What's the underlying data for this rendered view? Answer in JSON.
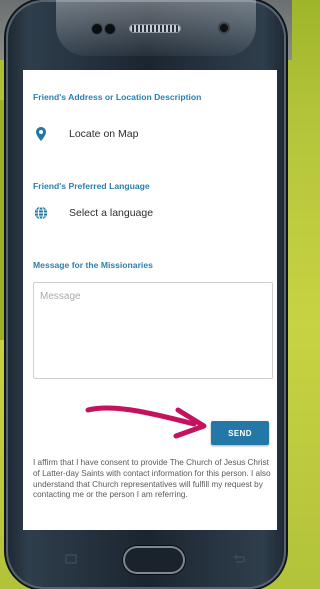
{
  "form": {
    "address_label": "Friend's Address or Location Description",
    "locate_text": "Locate on Map",
    "language_label": "Friend's Preferred Language",
    "language_text": "Select a language",
    "message_label": "Message for the Missionaries",
    "message_placeholder": "Message",
    "send_label": "SEND",
    "consent_text": "I affirm that I have consent to provide The Church of Jesus Christ of Latter-day Saints with contact information for this person. I also understand that Church representatives will fulfill my request by contacting me or the person I am referring."
  },
  "colors": {
    "accent": "#2478a8",
    "label_blue": "#2b7fae",
    "arrow": "#c4125e",
    "background_green": "#b4c43a"
  },
  "icons": {
    "location": "map-pin-icon",
    "language": "globe-icon",
    "annotation": "magenta-arrow-icon"
  }
}
